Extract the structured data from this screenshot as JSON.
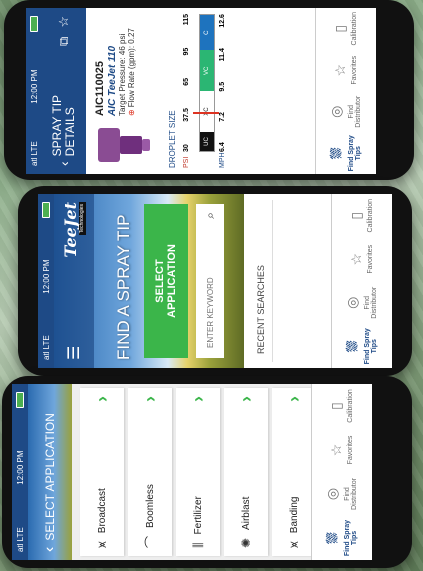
{
  "phone1": {
    "status": {
      "network": "atl LTE",
      "time": "12:00 PM"
    },
    "title": "SELECT APPLICATION",
    "items": [
      {
        "icon": "broadcast-icon",
        "label": "Broadcast"
      },
      {
        "icon": "boomless-icon",
        "label": "Boomless"
      },
      {
        "icon": "fertilizer-icon",
        "label": "Fertilizer"
      },
      {
        "icon": "airblast-icon",
        "label": "Airblast"
      },
      {
        "icon": "banding-icon",
        "label": "Banding"
      }
    ]
  },
  "phone2": {
    "status": {
      "network": "atl LTE",
      "time": "12:00 PM"
    },
    "brand": "TeeJet",
    "brand_sub": "Technologies",
    "hero_title": "FIND A SPRAY TIP",
    "select_button": "SELECT APPLICATION",
    "search_placeholder": "ENTER KEYWORD",
    "recent_label": "RECENT SEARCHES"
  },
  "phone3": {
    "status": {
      "network": "atl LTE",
      "time": "12:00 PM"
    },
    "title": "SPRAY TIP DETAILS",
    "part_no": "AIC110025",
    "model": "AIC TeeJet 110",
    "target_pressure": "Target Pressure: 46 psi",
    "flow_rate": "Flow Rate (gpm): 0.27",
    "droplet_label": "DROPLET SIZE",
    "psi_label": "PSI",
    "mph_label": "MPH",
    "psi_values": [
      "30",
      "37.5",
      "65",
      "95",
      "115"
    ],
    "mph_values": [
      "6.4",
      "7.2",
      "9.5",
      "11.4",
      "12.6"
    ],
    "segments": [
      {
        "label": "UC",
        "color": "#111111"
      },
      {
        "label": "XC",
        "color": "#ffffff"
      },
      {
        "label": "VC",
        "color": "#2bb673"
      },
      {
        "label": "C",
        "color": "#1e73be"
      }
    ]
  },
  "tabs": [
    {
      "icon": "spray-tips-icon",
      "label": "Find Spray Tips"
    },
    {
      "icon": "location-icon",
      "label": "Find Distributor"
    },
    {
      "icon": "star-icon",
      "label": "Favorites"
    },
    {
      "icon": "calibration-icon",
      "label": "Calibration"
    }
  ]
}
